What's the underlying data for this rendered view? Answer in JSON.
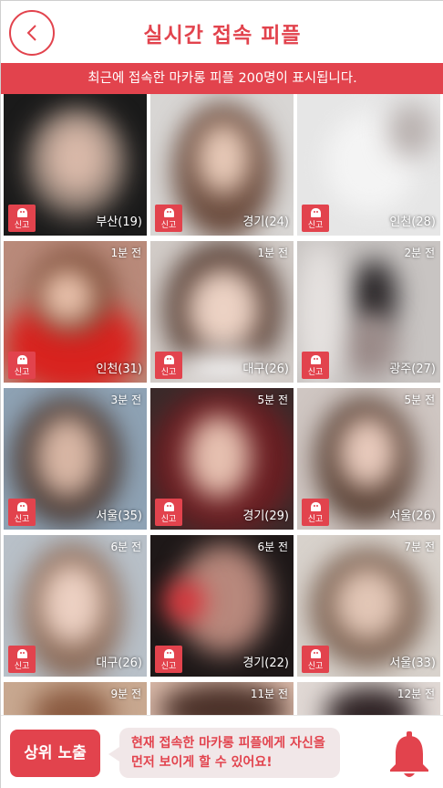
{
  "header": {
    "title": "실시간 접속 피플"
  },
  "banner": {
    "text": "최근에 접속한 마카롱 피플 200명이 표시됩니다."
  },
  "report_label": "신고",
  "people": [
    {
      "time": "",
      "location": "부산(19)"
    },
    {
      "time": "",
      "location": "경기(24)"
    },
    {
      "time": "",
      "location": "인천(28)"
    },
    {
      "time": "1분 전",
      "location": "인천(31)"
    },
    {
      "time": "1분 전",
      "location": "대구(26)"
    },
    {
      "time": "2분 전",
      "location": "광주(27)"
    },
    {
      "time": "3분 전",
      "location": "서울(35)"
    },
    {
      "time": "5분 전",
      "location": "경기(29)"
    },
    {
      "time": "5분 전",
      "location": "서울(26)"
    },
    {
      "time": "6분 전",
      "location": "대구(26)"
    },
    {
      "time": "6분 전",
      "location": "경기(22)"
    },
    {
      "time": "7분 전",
      "location": "서울(33)"
    },
    {
      "time": "9분 전",
      "location": ""
    },
    {
      "time": "11분 전",
      "location": ""
    },
    {
      "time": "12분 전",
      "location": ""
    }
  ],
  "footer": {
    "promote_label": "상위 노출",
    "message_line1": "현재 접속한 마카롱 피플에게 자신을",
    "message_line2": "먼저 보이게 할 수 있어요!"
  },
  "colors": {
    "accent": "#e2434d",
    "bubble": "#f1e7e8"
  },
  "icons": {
    "back": "chevron-left-icon",
    "report": "ghost-icon",
    "notify": "bell-icon"
  }
}
